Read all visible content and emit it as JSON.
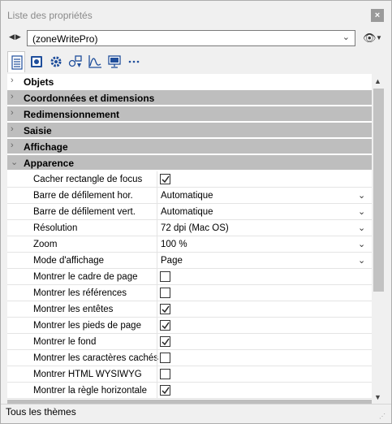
{
  "window": {
    "title": "Liste des propriétés",
    "close_glyph": "×"
  },
  "toolbar": {
    "nav_glyph": "◀▶",
    "object_name": "(zoneWritePro)",
    "object_chevron": "⌄",
    "eye_glyph": "👁",
    "eye_chevron": "▼",
    "icons": [
      "properties-list-icon",
      "form-icon",
      "gear-icon",
      "shapes-icon",
      "chart-icon",
      "monitor-icon",
      "more-icon"
    ]
  },
  "groups": [
    {
      "label": "Objets",
      "arrow": "›"
    },
    {
      "label": "Coordonnées et dimensions",
      "arrow": "›"
    },
    {
      "label": "Redimensionnement",
      "arrow": "›"
    },
    {
      "label": "Saisie",
      "arrow": "›"
    },
    {
      "label": "Affichage",
      "arrow": "›"
    },
    {
      "label": "Apparence",
      "arrow": "⌄"
    }
  ],
  "properties": [
    {
      "name": "Cacher rectangle de focus",
      "checked": true
    },
    {
      "name": "Barre de défilement hor.",
      "value": "Automatique",
      "dropdown": "⌄"
    },
    {
      "name": "Barre de défilement vert.",
      "value": "Automatique",
      "dropdown": "⌄"
    },
    {
      "name": "Résolution",
      "value": "72 dpi (Mac OS)",
      "dropdown": "⌄"
    },
    {
      "name": "Zoom",
      "value": "100 %",
      "dropdown": "⌄"
    },
    {
      "name": "Mode d'affichage",
      "value": "Page",
      "dropdown": "⌄"
    },
    {
      "name": "Montrer le cadre de page",
      "checked": false
    },
    {
      "name": "Montrer les références",
      "checked": false
    },
    {
      "name": "Montrer les entêtes",
      "checked": true
    },
    {
      "name": "Montrer les pieds de page",
      "checked": true
    },
    {
      "name": "Montrer le fond",
      "checked": true
    },
    {
      "name": "Montrer les caractères cachés",
      "checked": false
    },
    {
      "name": "Montrer HTML WYSIWYG",
      "checked": false
    },
    {
      "name": "Montrer la règle horizontale",
      "checked": true
    }
  ],
  "scrollbar": {
    "up": "▲",
    "down": "▼"
  },
  "footer": {
    "themes_label": "Tous les thèmes",
    "grip": "⋰"
  }
}
